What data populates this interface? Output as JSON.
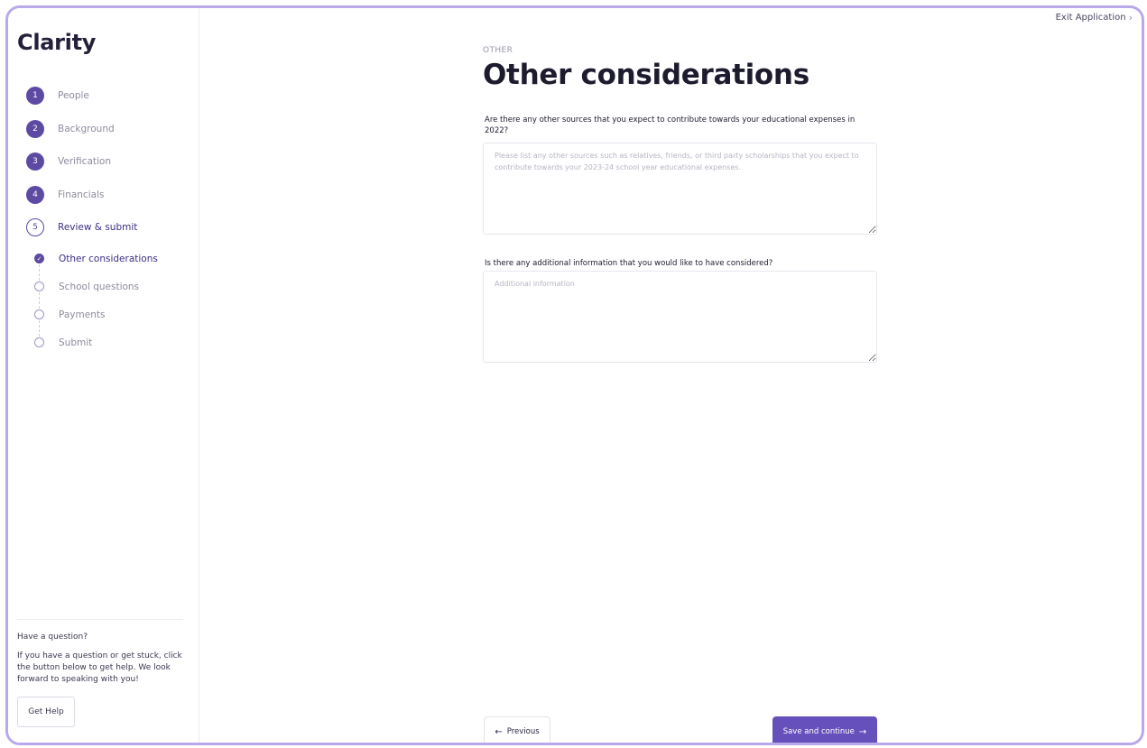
{
  "app": {
    "logo": "Clarity",
    "exit_label": "Exit Application"
  },
  "steps": [
    {
      "number": "1",
      "label": "People",
      "state": "complete"
    },
    {
      "number": "2",
      "label": "Background",
      "state": "complete"
    },
    {
      "number": "3",
      "label": "Verification",
      "state": "complete"
    },
    {
      "number": "4",
      "label": "Financials",
      "state": "complete"
    },
    {
      "number": "5",
      "label": "Review & submit",
      "state": "current"
    }
  ],
  "substeps": [
    {
      "label": "Other considerations",
      "state": "current"
    },
    {
      "label": "School questions",
      "state": "pending"
    },
    {
      "label": "Payments",
      "state": "pending"
    },
    {
      "label": "Submit",
      "state": "pending"
    }
  ],
  "help": {
    "title": "Have a question?",
    "text": "If you have a question or get stuck, click the button below to get help. We look forward to speaking with you!",
    "button_label": "Get Help"
  },
  "page": {
    "eyebrow": "OTHER",
    "title": "Other considerations",
    "question1": "Are there any other sources that you expect to contribute towards your educational expenses in 2022?",
    "question1_placeholder": "Please list any other sources such as relatives, friends, or third party scholarships that you expect to contribute towards your 2023-24 school year educational expenses.",
    "question1_value": "",
    "question2": "Is there any additional information that you would like to have considered?",
    "question2_placeholder": "Additional information",
    "question2_value": ""
  },
  "nav": {
    "previous_label": "Previous",
    "next_label": "Save and continue"
  },
  "colors": {
    "accent": "#6550bc",
    "frame_border": "#b9a9ea",
    "step_fill": "#5d4aa3"
  },
  "icons": {
    "back_arrow": "←",
    "forward_arrow": "→",
    "exit_chevron": "›",
    "check": "✓"
  }
}
